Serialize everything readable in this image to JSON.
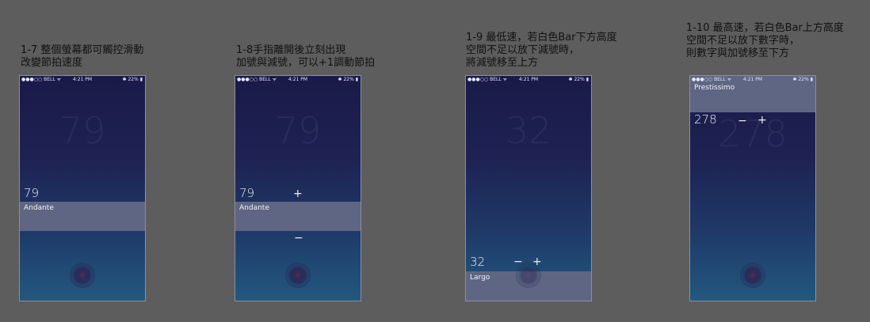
{
  "screens": [
    {
      "caption": [
        "1-7 整個螢幕都可觸控滑動",
        "改變節拍速度"
      ],
      "status": {
        "carrier": "●●●○○ BELL ᯤ",
        "time": "4:21 PM",
        "battery": "✱ 22% ▮"
      },
      "bpm": "79",
      "tempo_name": "Andante",
      "minus": "",
      "plus": ""
    },
    {
      "caption": [
        "1-8手指離開後立刻出現",
        "加號與減號，可以+1調動節拍"
      ],
      "status": {
        "carrier": "●●●○○ BELL ᯤ",
        "time": "4:21 PM",
        "battery": "✱ 22% ▮"
      },
      "bpm": "79",
      "tempo_name": "Andante",
      "minus": "−",
      "plus": "+"
    },
    {
      "caption": [
        "1-9 最低速，若白色Bar下方高度",
        "空間不足以放下減號時，",
        "將減號移至上方"
      ],
      "status": {
        "carrier": "●●●○○ BELL ᯤ",
        "time": "4:21 PM",
        "battery": "✱ 22% ▮"
      },
      "bpm": "32",
      "tempo_name": "Largo",
      "minus": "−",
      "plus": "+"
    },
    {
      "caption": [
        "1-10 最高速，若白色Bar上方高度",
        "空間不足以放下數字時，",
        "則數字與加號移至下方"
      ],
      "status": {
        "carrier": "●●●○○ BELL ᯤ",
        "time": "4:21 PM",
        "battery": "✱ 22% ▮"
      },
      "bpm": "278",
      "tempo_name": "Prestissimo",
      "minus": "−",
      "plus": "+"
    }
  ]
}
